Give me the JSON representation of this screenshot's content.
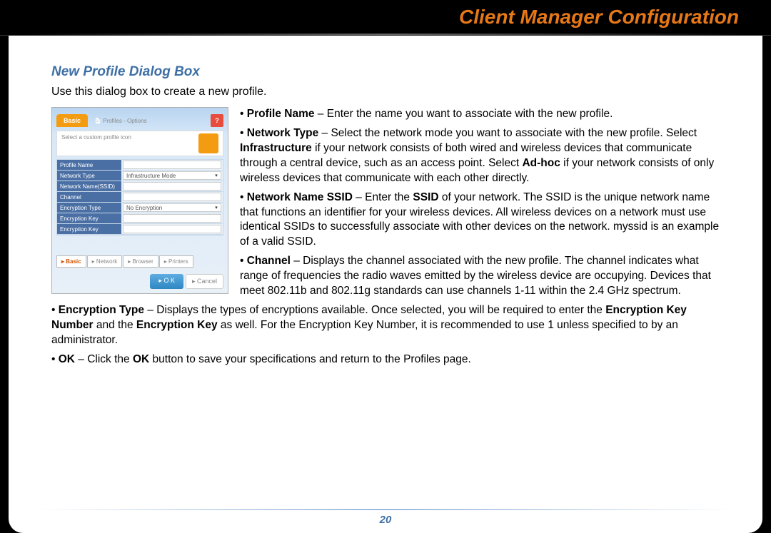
{
  "header": {
    "title": "Client Manager Configuration"
  },
  "section": {
    "title": "New Profile Dialog Box",
    "intro": "Use this dialog box to create a new profile.",
    "page_number": "20"
  },
  "dialog": {
    "tab_active": "Basic",
    "tab_secondary": "Profiles - Options",
    "help": "?",
    "icon_select_text": "Select a custom profile icon",
    "fields": [
      {
        "label": "Profile Name",
        "value": ""
      },
      {
        "label": "Network Type",
        "value": "Infrastructure Mode",
        "dropdown": true
      },
      {
        "label": "Network Name(SSID)",
        "value": ""
      },
      {
        "label": "Channel",
        "value": ""
      },
      {
        "label": "Encryption Type",
        "value": "No Encryption",
        "dropdown": true
      },
      {
        "label": "Encryption Key",
        "value": ""
      },
      {
        "label": "Encryption Key",
        "value": ""
      }
    ],
    "bottom_tabs": [
      "Basic",
      "Network",
      "Browser",
      "Printers"
    ],
    "ok": "O K",
    "cancel": "Cancel"
  },
  "bullets": {
    "profile_name_label": "Profile Name",
    "profile_name_text": " – Enter the name you want to associate with the new profile.",
    "network_type_label": "Network Type",
    "network_type_t1": " – Select the network mode you want to associate with the new profile. Select ",
    "network_type_b1": "Infrastructure",
    "network_type_t2": " if your network consists of both wired and wireless devices that communicate through a central device, such as an access point. Select ",
    "network_type_b2": "Ad-hoc",
    "network_type_t3": " if your network consists of only wireless devices that communicate with each other directly.",
    "ssid_label": "Network Name SSID",
    "ssid_t1": " – Enter the ",
    "ssid_b1": "SSID",
    "ssid_t2": " of your network. The SSID is the unique network name that functions an identifier for your wireless devices. All wireless devices on a network must use identical SSIDs to successfully associate with other devices on the network. myssid is an example of a valid SSID.",
    "channel_label": "Channel",
    "channel_text": " – Displays the channel associated with the new profile. The channel indicates what range of frequencies the radio waves emitted by the wireless device are occupying. Devices that meet 802.11b and 802.11g standards can use channels 1-11 within the 2.4 GHz spectrum.",
    "enc_label": "Encryption Type",
    "enc_t1": " –  Displays the types of encryptions available.  Once selected, you will be required to enter the ",
    "enc_b1": "Encryption Key Number",
    "enc_t2": " and the ",
    "enc_b2": "Encryption Key",
    "enc_t3": " as well.  For the Encryption Key Number, it is recommended to use 1 unless specified to by an administrator.",
    "ok_label": "OK",
    "ok_t1": " – Click the ",
    "ok_b1": "OK",
    "ok_t2": " button to save your specifications and return to the Profiles page."
  }
}
